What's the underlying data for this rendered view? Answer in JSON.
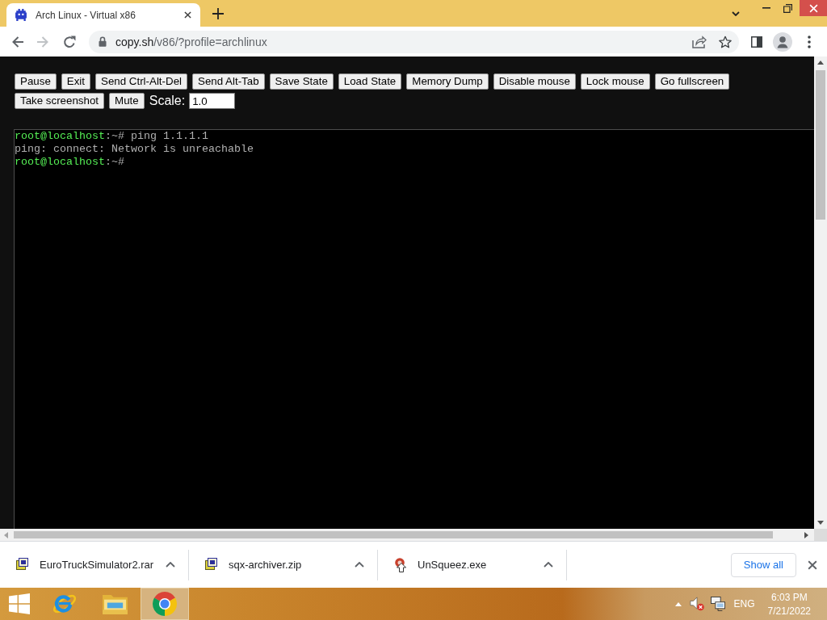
{
  "browser": {
    "tabs": [
      {
        "title": "Arch Linux - Virtual x86",
        "selected": true
      }
    ],
    "back_disabled": false,
    "forward_disabled": true,
    "address": {
      "host": "copy.sh",
      "path": "/v86/?profile=archlinux"
    }
  },
  "controls": {
    "buttons": [
      "Pause",
      "Exit",
      "Send Ctrl-Alt-Del",
      "Send Alt-Tab",
      "Save State",
      "Load State",
      "Memory Dump",
      "Disable mouse",
      "Lock mouse",
      "Go fullscreen",
      "Take screenshot",
      "Mute"
    ],
    "scale_label": "Scale:",
    "scale_value": "1.0"
  },
  "terminal": {
    "lines": [
      {
        "kind": "prompt",
        "user": "root@localhost",
        "symbol": ":~#",
        "command": "ping 1.1.1.1"
      },
      {
        "kind": "output",
        "text": "ping: connect: Network is unreachable"
      },
      {
        "kind": "prompt",
        "user": "root@localhost",
        "symbol": ":~#"
      }
    ]
  },
  "downloads": {
    "items": [
      {
        "file": "EuroTruckSimulator2.rar",
        "kind": "archive"
      },
      {
        "file": "sqx-archiver.zip",
        "kind": "archive"
      },
      {
        "file": "UnSqueez.exe",
        "kind": "program"
      }
    ],
    "show_all": "Show all"
  },
  "taskbar": {
    "apps": [
      {
        "kind": "e-logo",
        "selected": false
      },
      {
        "kind": "folder",
        "selected": false
      },
      {
        "kind": "circle-logo",
        "selected": true
      }
    ],
    "tray": {
      "muted": true,
      "language": "ENG",
      "time": "6:03 PM",
      "date": "7/21/2022"
    }
  }
}
